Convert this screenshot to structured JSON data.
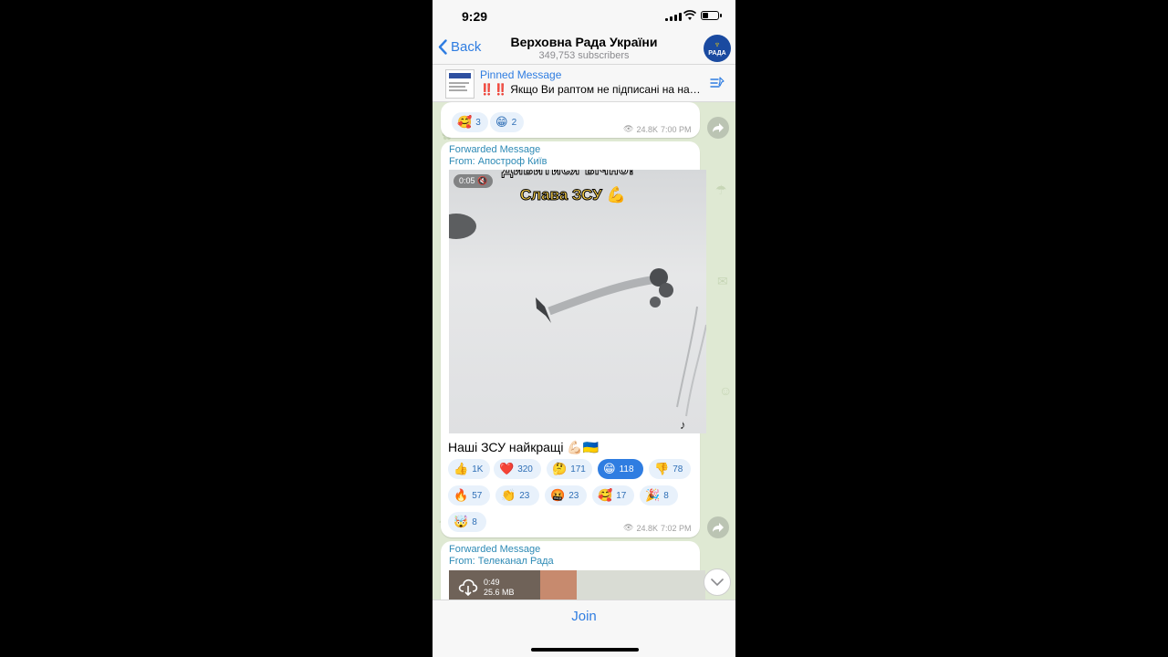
{
  "status": {
    "time": "9:29"
  },
  "header": {
    "back_label": "Back",
    "title": "Верховна Рада України",
    "subtitle": "349,753 subscribers",
    "avatar_text": "РАДА"
  },
  "pinned": {
    "label": "Pinned Message",
    "text": "Якщо Ви раптом не підписані на на…",
    "prefix": "‼️‼️"
  },
  "msg1": {
    "reactions": [
      {
        "emoji": "🥰",
        "count": "3"
      },
      {
        "emoji": "😁",
        "count": "2"
      }
    ],
    "views": "24.8K",
    "time": "7:00 PM"
  },
  "msg2": {
    "forward_label": "Forwarded Message",
    "forward_from": "From: Апостроф Київ",
    "video_duration": "0:05",
    "overlay_line1": "Дивитися вічно!",
    "overlay_line2": "Слава ЗСУ 💪",
    "caption": "Наші ЗСУ найкращі 💪🏻🇺🇦",
    "reactions": [
      {
        "emoji": "👍",
        "count": "1K"
      },
      {
        "emoji": "❤️",
        "count": "320"
      },
      {
        "emoji": "🤔",
        "count": "171"
      },
      {
        "emoji": "😁",
        "count": "118",
        "selected": true
      },
      {
        "emoji": "👎",
        "count": "78"
      },
      {
        "emoji": "🔥",
        "count": "57"
      },
      {
        "emoji": "👏",
        "count": "23"
      },
      {
        "emoji": "🤬",
        "count": "23"
      },
      {
        "emoji": "🥰",
        "count": "17"
      },
      {
        "emoji": "🎉",
        "count": "8"
      },
      {
        "emoji": "🤯",
        "count": "8"
      }
    ],
    "views": "24.8K",
    "time": "7:02 PM"
  },
  "msg3": {
    "forward_label": "Forwarded Message",
    "forward_from": "From: Телеканал Рада",
    "video_duration": "0:49",
    "video_size": "25.6 MB"
  },
  "footer": {
    "join_label": "Join"
  },
  "colors": {
    "accent": "#2f7de1",
    "wallpaper": "#dfe9d3",
    "forward": "#2d8ab5"
  }
}
